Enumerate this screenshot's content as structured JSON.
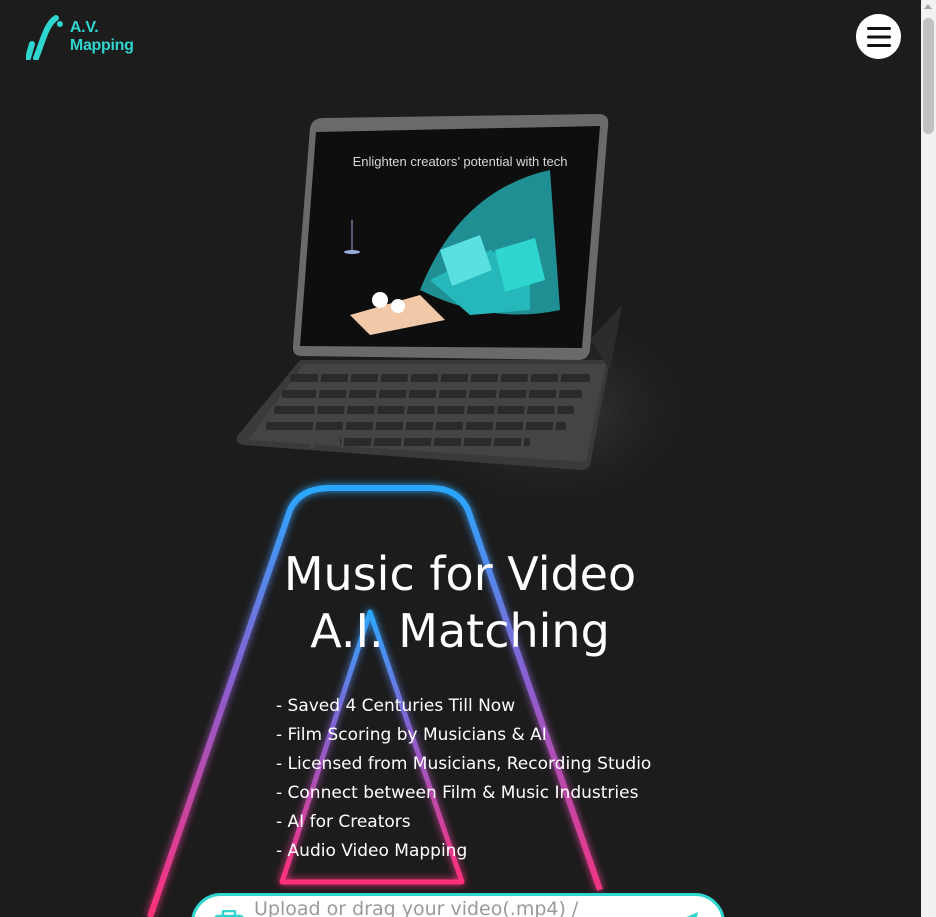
{
  "header": {
    "logo_text": "A.V. Mapping",
    "menu_icon": "hamburger-icon"
  },
  "illustration": {
    "caption": "Enlighten creators’ potential with tech"
  },
  "hero": {
    "title_line1": "Music for Video",
    "title_line2": "A.I. Matching",
    "features": [
      "- Saved 4 Centuries Till Now",
      "- Film Scoring by Musicians & AI",
      "- Licensed from Musicians, Recording Studio",
      "- Connect between Film & Music Industries",
      "- AI for Creators",
      "- Audio Video Mapping"
    ]
  },
  "upload": {
    "placeholder": "Upload or drag your video(.mp4) /"
  },
  "colors": {
    "background": "#1c1c1c",
    "accent": "#2fd6cf",
    "neon_blue": "#2aa8ff",
    "neon_pink": "#ff2f7a"
  }
}
